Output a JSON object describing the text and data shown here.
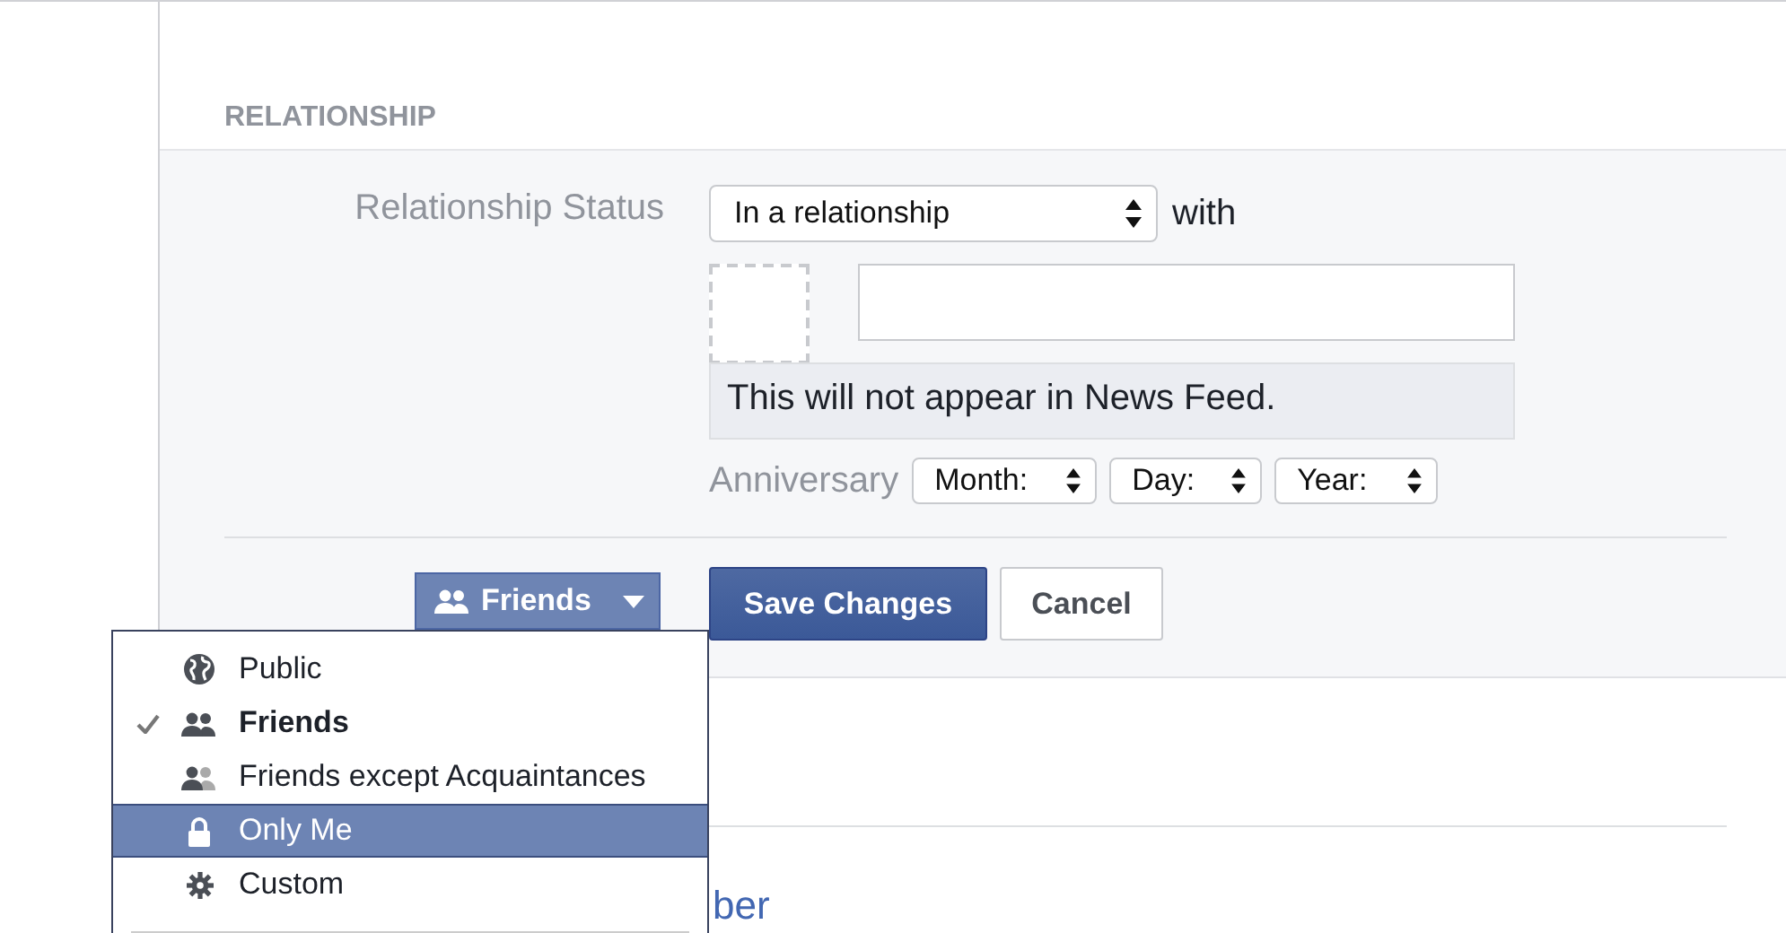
{
  "section": {
    "title": "RELATIONSHIP"
  },
  "form": {
    "status_label": "Relationship Status",
    "status_value": "In a relationship",
    "with_label": "with",
    "note": "This will not appear in News Feed.",
    "anniversary_label": "Anniversary",
    "date_selects": [
      "Month:",
      "Day:",
      "Year:"
    ]
  },
  "privacy_button": {
    "label": "Friends",
    "open": true
  },
  "buttons": {
    "save": "Save Changes",
    "cancel": "Cancel"
  },
  "link_fragment": "ber",
  "privacy_menu": [
    {
      "label": "Public",
      "selected": false,
      "highlighted": false
    },
    {
      "label": "Friends",
      "selected": true,
      "highlighted": false
    },
    {
      "label": "Friends except Acquaintances",
      "selected": false,
      "highlighted": false
    },
    {
      "label": "Only Me",
      "selected": false,
      "highlighted": true
    },
    {
      "label": "Custom",
      "selected": false,
      "highlighted": false
    }
  ]
}
